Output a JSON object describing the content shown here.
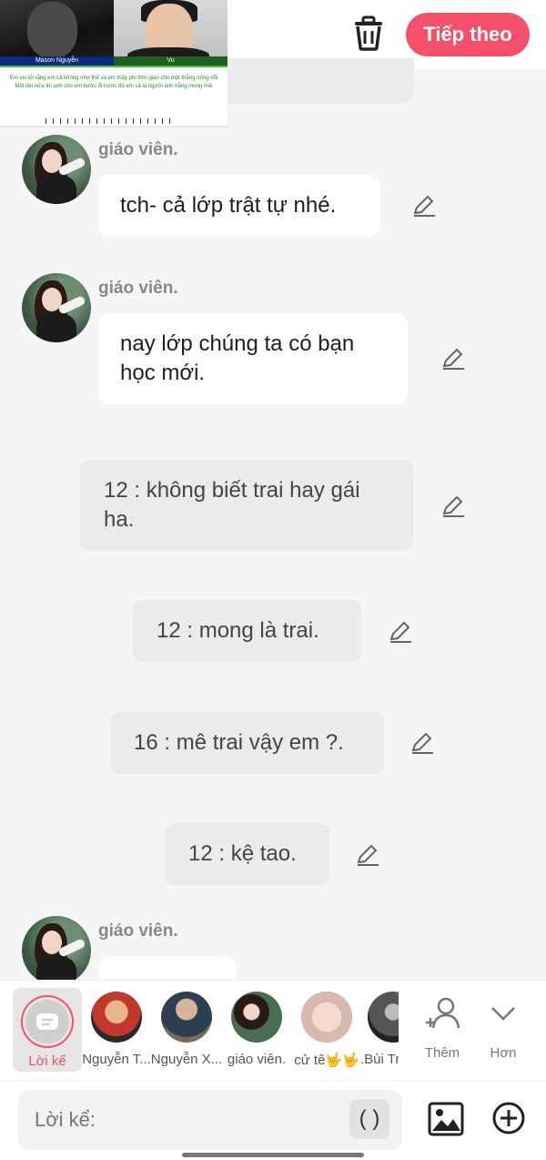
{
  "header": {
    "next_label": "Tiếp theo",
    "thumbnail": {
      "left_name": "Mason Nguyễn",
      "right_name": "Vu",
      "lyric_line1": "Em xin lỗi rằng em cả không như thế và em thấy phí thời gian cho một thằng nông nổi",
      "lyric_line2": "Một lần nữa thì anh cho em bước đi trước đó em cả là người anh hằng mong mỏi"
    }
  },
  "messages": [
    {
      "speaker": "giáo viên.",
      "text": "tch- cả lớp trật tự nhé."
    },
    {
      "speaker": "giáo viên.",
      "text": "nay lớp chúng ta có bạn học mới."
    }
  ],
  "narrations": [
    {
      "text": "12 : không biết trai hay gái ha."
    },
    {
      "text": "12 : mong là trai."
    },
    {
      "text": "16 : mê trai vậy em ?."
    },
    {
      "text": "12 : kệ tao."
    }
  ],
  "partial_message": {
    "speaker": "giáo viên."
  },
  "characters": [
    {
      "name": "Lời kể",
      "selected": true
    },
    {
      "name": "Nguyễn T...",
      "color": "#c0392b"
    },
    {
      "name": "Nguyễn X...",
      "color": "#2c3e50"
    },
    {
      "name": "giáo viên.",
      "color": "#4b6b52"
    },
    {
      "name": "cử tê🤟🤟",
      "color": "#d9b8b0"
    },
    {
      "name": ".Bùi Tr",
      "color": "#555555"
    }
  ],
  "tools": {
    "add_label": "Thêm",
    "more_label": "Hơn"
  },
  "input": {
    "placeholder": "Lời kể:",
    "paren_label": "( )"
  },
  "colors": {
    "accent": "#f4506a",
    "narration_bg": "#ebebeb",
    "bubble_bg": "#ffffff"
  }
}
